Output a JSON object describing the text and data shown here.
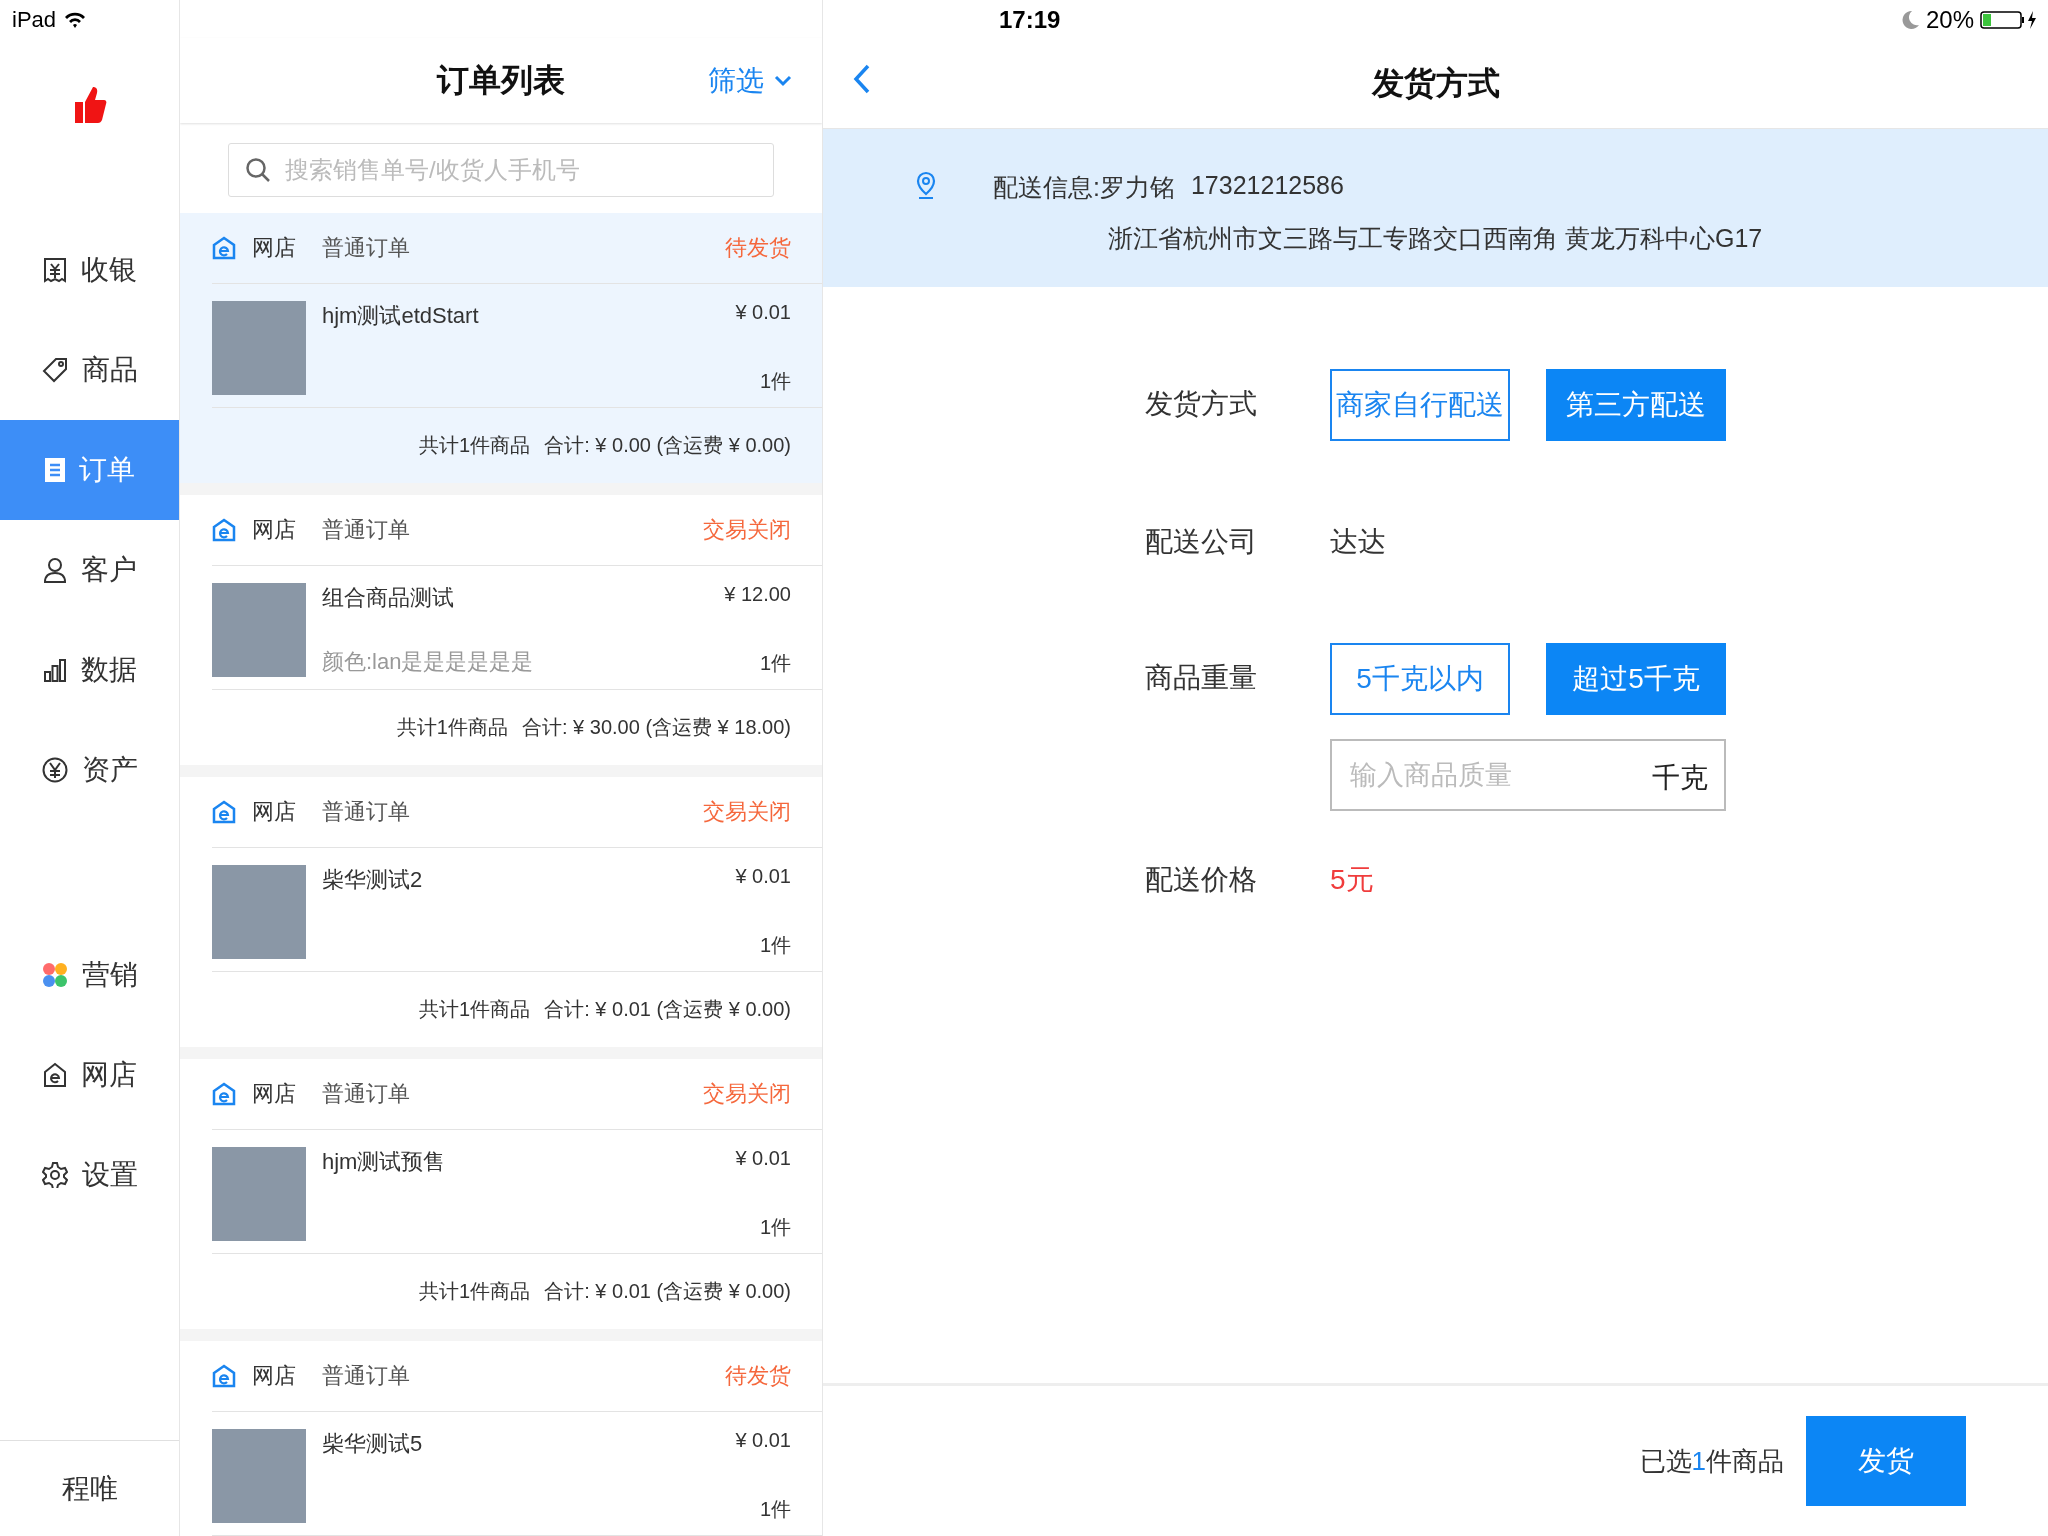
{
  "status_bar": {
    "device": "iPad",
    "time": "17:19",
    "battery": "20%"
  },
  "sidebar": {
    "items": [
      {
        "kind": "receipt",
        "label": "收银",
        "selected": false
      },
      {
        "kind": "tag",
        "label": "商品",
        "selected": false
      },
      {
        "kind": "document",
        "label": "订单",
        "selected": true
      },
      {
        "kind": "person",
        "label": "客户",
        "selected": false
      },
      {
        "kind": "chart",
        "label": "数据",
        "selected": false
      },
      {
        "kind": "yuan",
        "label": "资产",
        "selected": false
      },
      {
        "kind": "marketing",
        "label": "营销",
        "selected": false
      },
      {
        "kind": "shop",
        "label": "网店",
        "selected": false
      },
      {
        "kind": "gear",
        "label": "设置",
        "selected": false
      }
    ],
    "user": "程唯"
  },
  "order_list": {
    "title": "订单列表",
    "filter": "筛选",
    "search": {
      "placeholder": "搜索销售单号/收货人手机号"
    },
    "orders": [
      {
        "selected": true,
        "store": "网店",
        "type": "普通订单",
        "status": "待发货",
        "items": [
          {
            "name": "hjm测试etdStart",
            "price": "¥ 0.01",
            "quantity": "1件"
          }
        ],
        "count": "共计1件商品",
        "total": "合计: ¥ 0.00 (含运费 ¥ 0.00)"
      },
      {
        "selected": false,
        "store": "网店",
        "type": "普通订单",
        "status": "交易关闭",
        "items": [
          {
            "name": "组合商品测试",
            "price": "¥ 12.00",
            "variant": "颜色:lan是是是是是是",
            "quantity": "1件"
          }
        ],
        "count": "共计1件商品",
        "total": "合计: ¥ 30.00 (含运费 ¥ 18.00)"
      },
      {
        "selected": false,
        "store": "网店",
        "type": "普通订单",
        "status": "交易关闭",
        "items": [
          {
            "name": "柴华测试2",
            "price": "¥ 0.01",
            "quantity": "1件"
          }
        ],
        "count": "共计1件商品",
        "total": "合计: ¥ 0.01 (含运费 ¥ 0.00)"
      },
      {
        "selected": false,
        "store": "网店",
        "type": "普通订单",
        "status": "交易关闭",
        "items": [
          {
            "name": "hjm测试预售",
            "price": "¥ 0.01",
            "quantity": "1件"
          }
        ],
        "count": "共计1件商品",
        "total": "合计: ¥ 0.01 (含运费 ¥ 0.00)"
      },
      {
        "selected": false,
        "store": "网店",
        "type": "普通订单",
        "status": "待发货",
        "items": [
          {
            "name": "柴华测试5",
            "price": "¥ 0.01",
            "quantity": "1件"
          }
        ]
      }
    ]
  },
  "shipping": {
    "title": "发货方式",
    "delivery_info": {
      "contact": "配送信息:罗力铭",
      "phone": "17321212586",
      "address": "浙江省杭州市文三路与工专路交口西南角 黄龙万科中心G17"
    },
    "form": [
      {
        "kind": "options",
        "label": "发货方式",
        "options": [
          {
            "label": "商家自行配送",
            "selected": false
          },
          {
            "label": "第三方配送",
            "selected": true
          }
        ]
      },
      {
        "kind": "text",
        "label": "配送公司",
        "value": "达达"
      },
      {
        "kind": "options",
        "label": "商品重量",
        "options": [
          {
            "label": "5千克以内",
            "selected": false
          },
          {
            "label": "超过5千克",
            "selected": true
          }
        ],
        "input": {
          "placeholder": "输入商品质量",
          "unit": "千克"
        }
      },
      {
        "kind": "price",
        "label": "配送价格",
        "value": "5元"
      }
    ],
    "footer": {
      "summary": {
        "before": "已选",
        "count": "1",
        "after": "件商品"
      },
      "button": "发货"
    }
  }
}
